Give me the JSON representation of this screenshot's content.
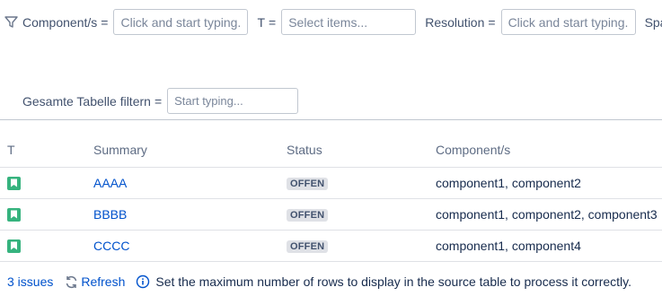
{
  "filters": {
    "component": {
      "label": "Component/s",
      "eq": "=",
      "placeholder": "Click and start typing..."
    },
    "type": {
      "label": "T",
      "eq": "=",
      "placeholder": "Select items..."
    },
    "resolution": {
      "label": "Resolution",
      "eq": "=",
      "placeholder": "Click and start typing..."
    },
    "truncated_label": "Spa",
    "table_filter": {
      "label": "Gesamte Tabelle filtern",
      "eq": "=",
      "placeholder": "Start typing..."
    }
  },
  "table": {
    "headers": {
      "type": "T",
      "summary": "Summary",
      "status": "Status",
      "components": "Component/s"
    },
    "rows": [
      {
        "summary": "AAAA",
        "status": "OFFEN",
        "components": "component1, component2"
      },
      {
        "summary": "BBBB",
        "status": "OFFEN",
        "components": "component1, component2, component3"
      },
      {
        "summary": "CCCC",
        "status": "OFFEN",
        "components": "component1, component4"
      }
    ]
  },
  "footer": {
    "issue_count": "3 issues",
    "refresh_label": "Refresh",
    "info_text": "Set the maximum number of rows to display in the source table to process it correctly."
  },
  "icons": {
    "filter": "funnel-icon",
    "issue_type": "bookmark-story-icon",
    "refresh": "refresh-icon",
    "info": "info-icon"
  },
  "colors": {
    "link": "#0052cc",
    "story_icon": "#36b37e",
    "lozenge_bg": "#dfe1e6"
  }
}
